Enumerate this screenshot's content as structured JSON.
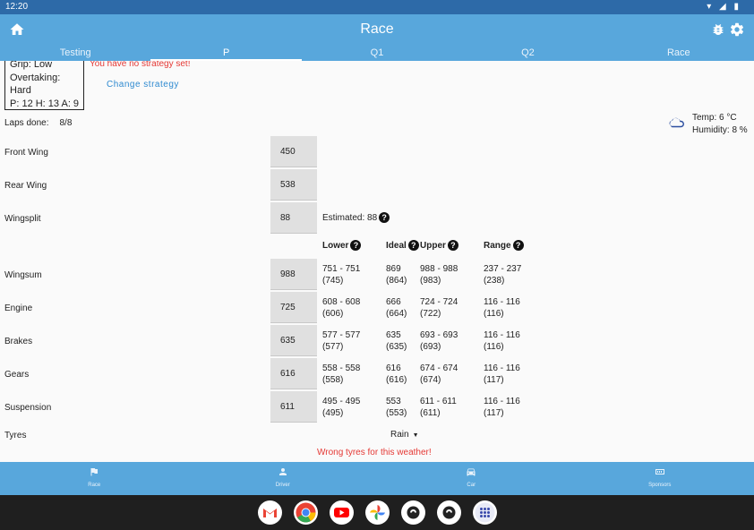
{
  "status_bar": {
    "time": "12:20",
    "icons": "▾ ◢ ▮"
  },
  "app_bar": {
    "title": "Race"
  },
  "tabs": [
    {
      "label": "Testing"
    },
    {
      "label": "P"
    },
    {
      "label": "Q1"
    },
    {
      "label": "Q2"
    },
    {
      "label": "Race"
    }
  ],
  "active_tab": "P",
  "track": {
    "grip": "Grip: Low",
    "overtaking": "Overtaking: Hard",
    "pit_info": "P: 12 H: 13 A: 9"
  },
  "strategy": {
    "warning": "You have no strategy set!",
    "change_label": "Change strategy"
  },
  "laps": {
    "label": "Laps done:",
    "value": "8/8"
  },
  "weather": {
    "temp": "Temp: 6 °C",
    "humidity": "Humidity: 8 %",
    "icon": "cloud-icon"
  },
  "setup": {
    "front_wing": {
      "label": "Front Wing",
      "value": "450"
    },
    "rear_wing": {
      "label": "Rear Wing",
      "value": "538"
    },
    "wingsplit": {
      "label": "Wingsplit",
      "value": "88",
      "estimated": "Estimated: 88"
    }
  },
  "headers": {
    "lower": "Lower",
    "ideal": "Ideal",
    "upper": "Upper",
    "range": "Range"
  },
  "rows": [
    {
      "label": "Wingsum",
      "value": "988",
      "lower": "751 - 751",
      "lower_sub": "(745)",
      "ideal": "869",
      "ideal_sub": "(864)",
      "upper": "988 - 988",
      "upper_sub": "(983)",
      "range": "237 - 237",
      "range_sub": "(238)"
    },
    {
      "label": "Engine",
      "value": "725",
      "lower": "608 - 608",
      "lower_sub": "(606)",
      "ideal": "666",
      "ideal_sub": "(664)",
      "upper": "724 - 724",
      "upper_sub": "(722)",
      "range": "116 - 116",
      "range_sub": "(116)"
    },
    {
      "label": "Brakes",
      "value": "635",
      "lower": "577 - 577",
      "lower_sub": "(577)",
      "ideal": "635",
      "ideal_sub": "(635)",
      "upper": "693 - 693",
      "upper_sub": "(693)",
      "range": "116 - 116",
      "range_sub": "(116)"
    },
    {
      "label": "Gears",
      "value": "616",
      "lower": "558 - 558",
      "lower_sub": "(558)",
      "ideal": "616",
      "ideal_sub": "(616)",
      "upper": "674 - 674",
      "upper_sub": "(674)",
      "range": "116 - 116",
      "range_sub": "(117)"
    },
    {
      "label": "Suspension",
      "value": "611",
      "lower": "495 - 495",
      "lower_sub": "(495)",
      "ideal": "553",
      "ideal_sub": "(553)",
      "upper": "611 - 611",
      "upper_sub": "(611)",
      "range": "116 - 116",
      "range_sub": "(117)"
    }
  ],
  "tyres": {
    "label": "Tyres",
    "selected": "Rain",
    "warning": "Wrong tyres for this weather!"
  },
  "bottom_nav": [
    {
      "label": "Race",
      "icon": "flag-icon"
    },
    {
      "label": "Driver",
      "icon": "person-icon"
    },
    {
      "label": "Car",
      "icon": "car-icon"
    },
    {
      "label": "Sponsors",
      "icon": "sponsors-icon"
    }
  ],
  "dock": [
    "gmail-icon",
    "chrome-icon",
    "youtube-icon",
    "photos-icon",
    "app-icon",
    "app-icon",
    "app-drawer-icon"
  ],
  "colors": {
    "accent": "#58a7dc",
    "status_bar": "#2d6aa8",
    "warning": "#e53935",
    "link": "#2f8ad0",
    "input_bg": "#e0e0e0"
  }
}
